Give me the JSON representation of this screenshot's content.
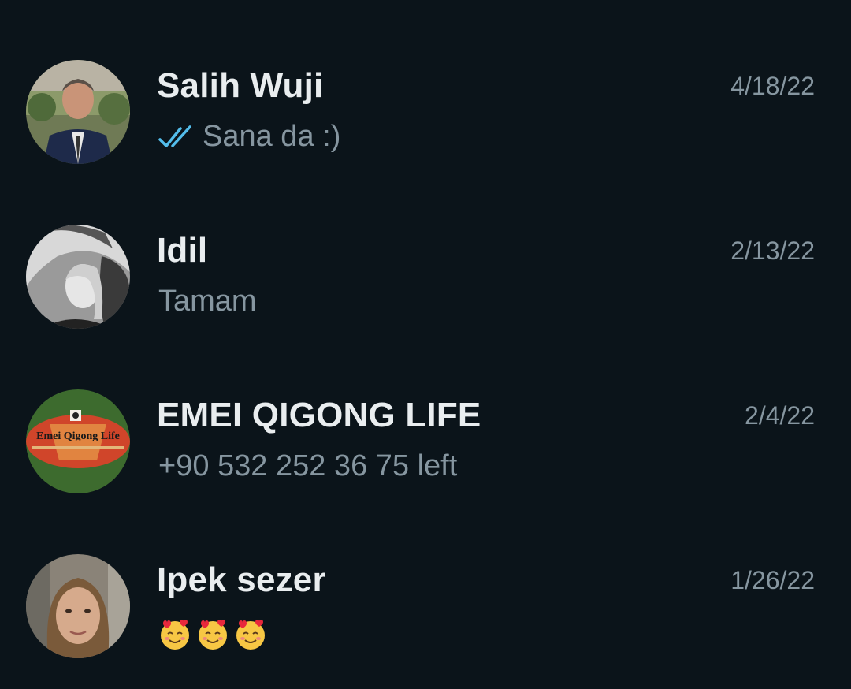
{
  "chats": [
    {
      "name": "Salih Wuji",
      "date": "4/18/22",
      "preview": "Sana da :)",
      "read_status": "double-check-read-icon",
      "avatar_icon": "contact-photo-icon"
    },
    {
      "name": "Idil",
      "date": "2/13/22",
      "preview": "Tamam",
      "avatar_icon": "contact-photo-icon"
    },
    {
      "name": "EMEI QIGONG LIFE",
      "date": "2/4/22",
      "preview": "+90 532 252 36 75 left",
      "avatar_icon": "group-logo-icon",
      "avatar_logo_text": "Emei Qigong Life"
    },
    {
      "name": "Ipek sezer",
      "date": "1/26/22",
      "preview_emojis": [
        "smiling-face-with-hearts-icon",
        "smiling-face-with-hearts-icon",
        "smiling-face-with-hearts-icon"
      ],
      "avatar_icon": "contact-photo-icon"
    }
  ],
  "colors": {
    "background": "#0b141a",
    "name_text": "#e9edef",
    "secondary_text": "#8696a0",
    "read_tick": "#53bdeb"
  }
}
